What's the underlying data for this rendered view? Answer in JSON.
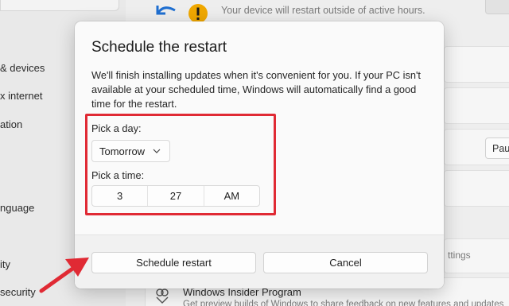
{
  "background": {
    "nav_items": [
      "& devices",
      "x internet",
      "ation",
      "nguage",
      "ity",
      "security"
    ],
    "update_notice": "Your device will restart outside of active hours.",
    "pause_button_label": "Pau",
    "settings_fragment": "ttings",
    "insider_title": "Windows Insider Program",
    "insider_subtitle": "Get preview builds of Windows to share feedback on new features and updates",
    "icon_names": [
      "sync-arrow-icon",
      "warning-icon",
      "insider-icon"
    ]
  },
  "dialog": {
    "title": "Schedule the restart",
    "description": "We'll finish installing updates when it's convenient for you. If your PC isn't available at your scheduled time, Windows will automatically find a good time for the restart.",
    "day_label": "Pick a day:",
    "day_value": "Tomorrow",
    "time_label": "Pick a time:",
    "time": {
      "hour": "3",
      "minute": "27",
      "period": "AM"
    },
    "primary_button": "Schedule restart",
    "secondary_button": "Cancel"
  },
  "colors": {
    "highlight": "#e02a34",
    "warning": "#f0a800",
    "accent": "#1f6fd1"
  }
}
